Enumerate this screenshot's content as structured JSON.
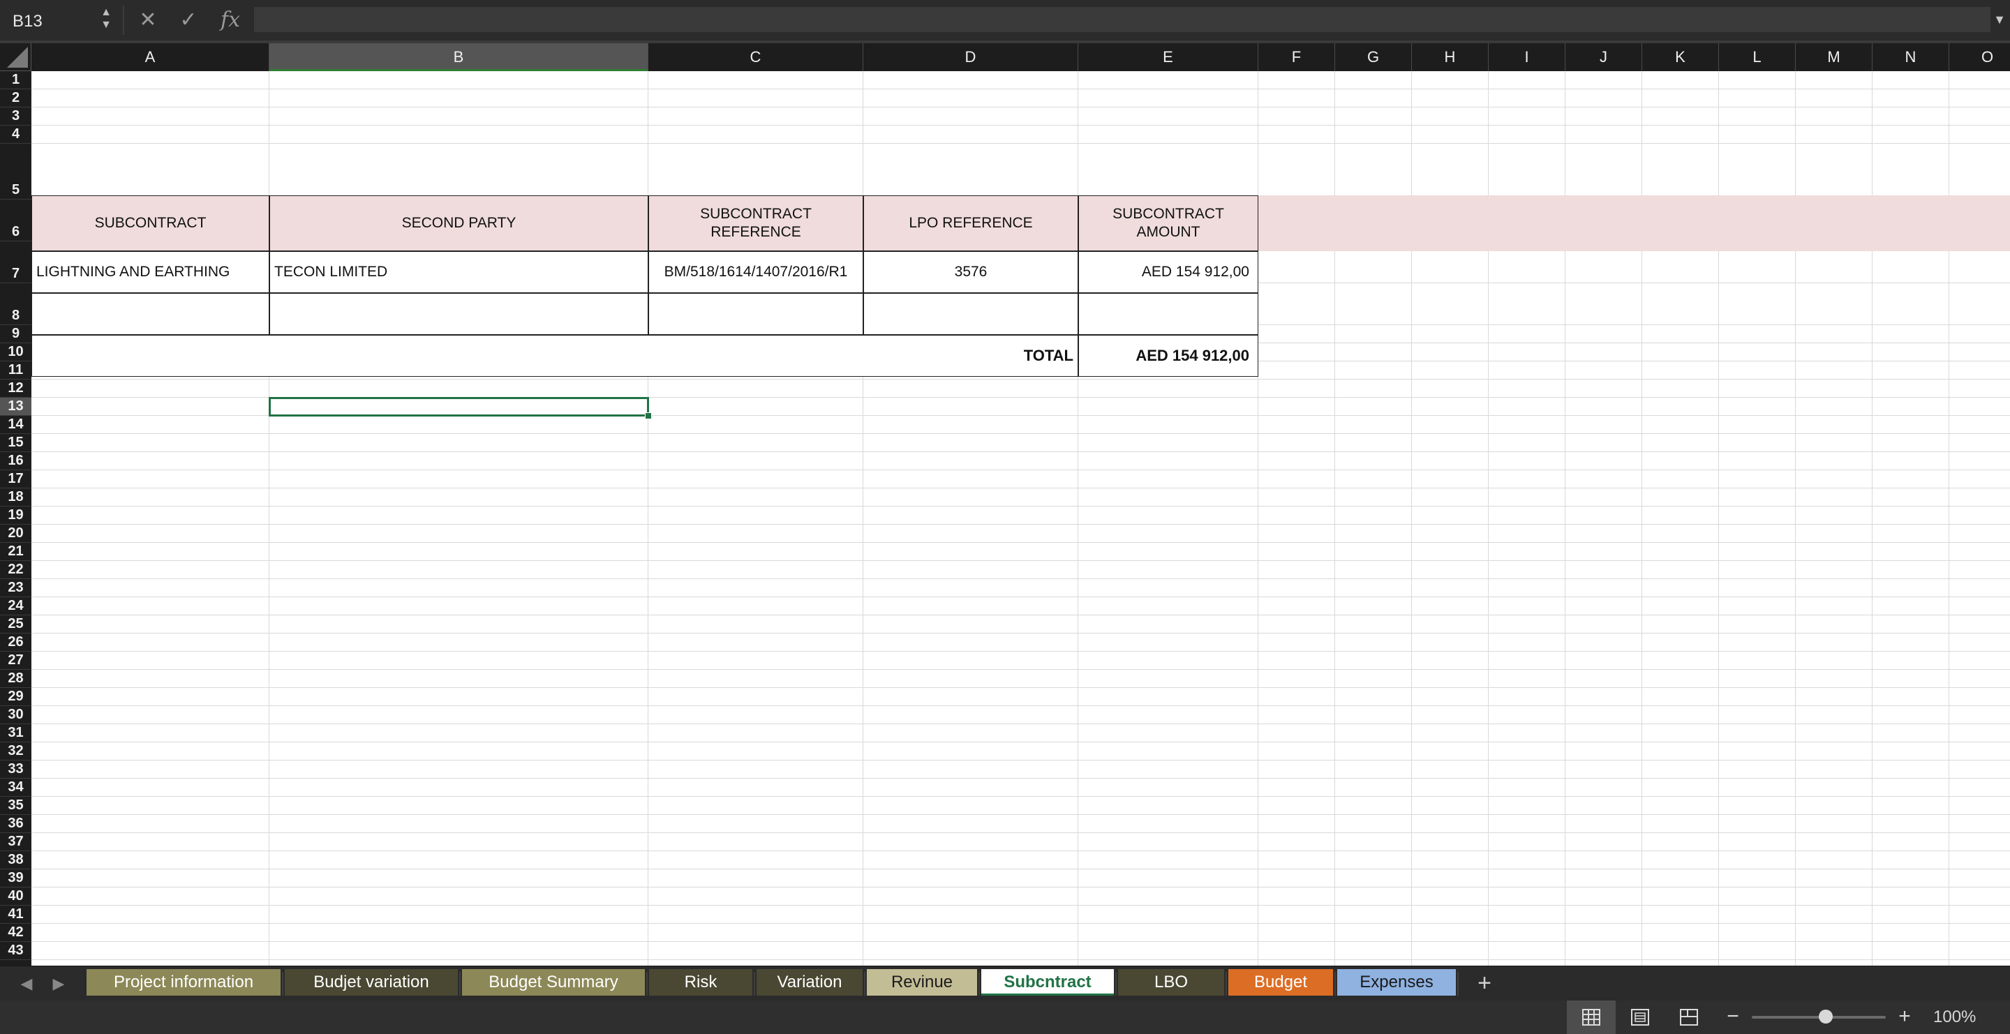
{
  "formula_bar": {
    "name_box": "B13",
    "cancel_glyph": "✕",
    "confirm_glyph": "✓",
    "fx_glyph": "fx",
    "formula_value": ""
  },
  "selection": {
    "cell": "B13",
    "column": "B",
    "row": "13"
  },
  "columns": [
    "A",
    "B",
    "C",
    "D",
    "E",
    "F",
    "G",
    "H",
    "I",
    "J",
    "K",
    "L",
    "M",
    "N",
    "O"
  ],
  "rows": [
    "1",
    "2",
    "3",
    "4",
    "5",
    "6",
    "7",
    "8",
    "9",
    "10",
    "11",
    "12",
    "13",
    "14",
    "15",
    "16",
    "17",
    "18",
    "19",
    "20",
    "21",
    "22",
    "23",
    "24",
    "25",
    "26",
    "27",
    "28",
    "29",
    "30",
    "31",
    "32",
    "33",
    "34",
    "35",
    "36",
    "37",
    "38",
    "39",
    "40",
    "41",
    "42",
    "43"
  ],
  "sheet": {
    "headers": {
      "subcontract": "SUBCONTRACT",
      "second_party": "SECOND PARTY",
      "subcontract_reference": "SUBCONTRACT REFERENCE",
      "lpo_reference": "LPO REFERENCE",
      "subcontract_amount": "SUBCONTRACT AMOUNT"
    },
    "row6": {
      "subcontract": "LIGHTNING AND EARTHING",
      "second_party": "TECON LIMITED",
      "subcontract_reference": "BM/518/1614/1407/2016/R1",
      "lpo_reference": "3576",
      "subcontract_amount": "AED 154 912,00"
    },
    "total_label": "TOTAL",
    "total_amount": "AED 154 912,00",
    "header_fill_color": "#f0dcdc"
  },
  "tabs": [
    {
      "label": "Project information",
      "bg": "#8c8858",
      "fg": "#ffffff"
    },
    {
      "label": "Budjet variation",
      "bg": "#4a4833",
      "fg": "#ffffff"
    },
    {
      "label": "Budget Summary",
      "bg": "#8c8858",
      "fg": "#ffffff"
    },
    {
      "label": "Risk",
      "bg": "#4a4833",
      "fg": "#ffffff"
    },
    {
      "label": "Variation",
      "bg": "#4a4833",
      "fg": "#ffffff"
    },
    {
      "label": "Revinue",
      "bg": "#c3bd96",
      "fg": "#1a1a1a"
    },
    {
      "label": "Subcntract",
      "bg": "#ffffff",
      "fg": "#217346",
      "active": true
    },
    {
      "label": "LBO",
      "bg": "#4a4833",
      "fg": "#ffffff"
    },
    {
      "label": "Budget",
      "bg": "#dc6d24",
      "fg": "#ffffff"
    },
    {
      "label": "Expenses",
      "bg": "#8fb2e0",
      "fg": "#1a1a1a"
    }
  ],
  "add_sheet_glyph": "+",
  "status_bar": {
    "zoom": "100%",
    "zoom_fraction": 0.55,
    "views": [
      "normal-view",
      "page-layout-view",
      "page-break-preview"
    ],
    "active_view": "normal-view"
  },
  "colors": {
    "accent": "#217346",
    "chrome": "#2b2b2b"
  }
}
